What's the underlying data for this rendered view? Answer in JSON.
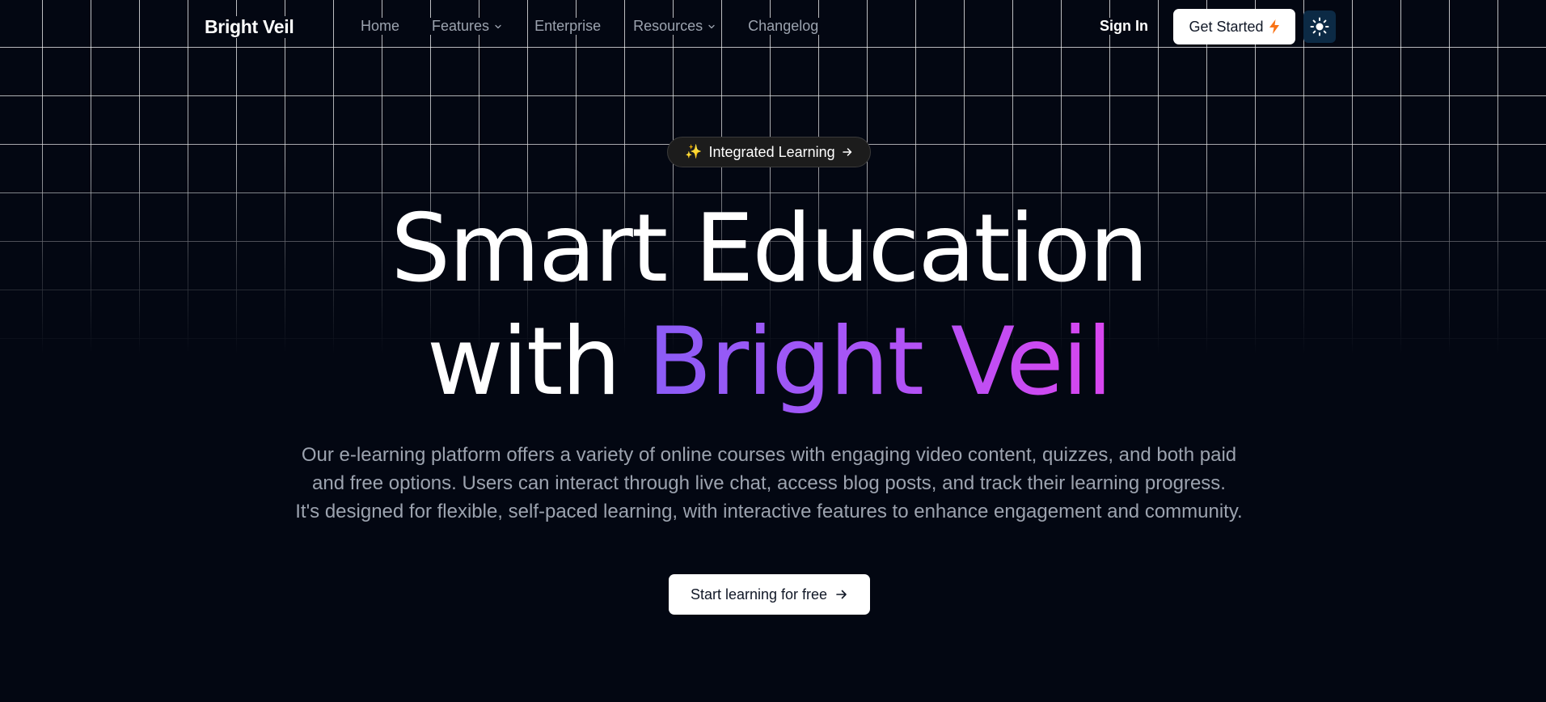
{
  "brand": {
    "name": "Bright Veil"
  },
  "nav": {
    "links": [
      {
        "label": "Home",
        "has_dropdown": false
      },
      {
        "label": "Features",
        "has_dropdown": true
      },
      {
        "label": "Enterprise",
        "has_dropdown": false
      },
      {
        "label": "Resources",
        "has_dropdown": true
      },
      {
        "label": "Changelog",
        "has_dropdown": false
      }
    ],
    "sign_in_label": "Sign In",
    "get_started_label": "Get Started",
    "get_started_icon": "lightning-icon",
    "theme_toggle_icon": "sun-icon"
  },
  "hero": {
    "badge_icon": "sparkles-icon",
    "badge_label": "Integrated Learning",
    "badge_arrow_icon": "arrow-right-icon",
    "title_line1": "Smart Education",
    "title_line2_prefix": "with",
    "title_line2_highlight": "Bright Veil",
    "description_lines": [
      "Our e-learning platform offers a variety of online courses with engaging video content, quizzes, and both paid",
      "and free options. Users can interact through live chat, access blog posts, and track their learning progress.",
      "It's designed for flexible, self-paced learning, with interactive features to enhance engagement and community."
    ],
    "cta_label": "Start learning for free",
    "cta_icon": "arrow-right-icon"
  },
  "colors": {
    "background": "#030712",
    "gradient_start": "#8b5cf6",
    "gradient_end": "#d946ef",
    "lightning": "#f97316",
    "theme_toggle_bg": "#0c2a45"
  }
}
